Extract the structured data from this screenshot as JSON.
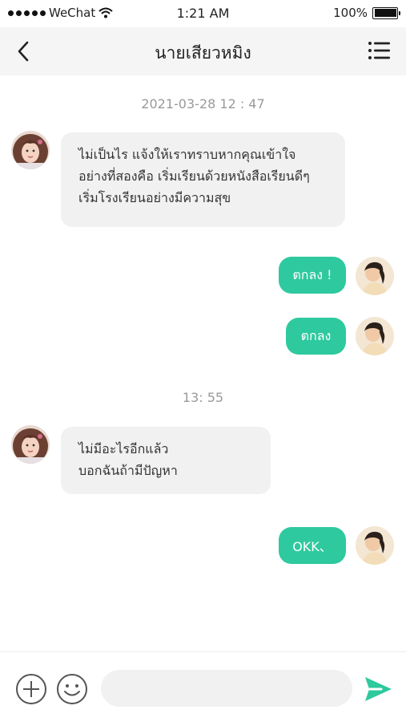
{
  "status_bar": {
    "carrier": "WeChat",
    "time": "1:21 AM",
    "battery": "100%"
  },
  "nav": {
    "title": "นายเสียวหมิง",
    "back_icon": "chevron-left-icon",
    "menu_icon": "list-menu-icon"
  },
  "chat": {
    "timestamps": [
      "2021-03-28  12 : 47",
      "13:  55"
    ],
    "messages": [
      {
        "side": "in",
        "lines": [
          "ไม่เป็นไร แจ้งให้เราทราบหากคุณเข้าใจ",
          "อย่างที่สองคือ เริ่มเรียนด้วยหนังสือเรียนดีๆ",
          "เริ่มโรงเรียนอย่างมีความสุข"
        ]
      },
      {
        "side": "out",
        "text": "ตกลง !"
      },
      {
        "side": "out",
        "text": "ตกลง"
      },
      {
        "side": "in",
        "lines": [
          "ไม่มีอะไรอีกแล้ว",
          "บอกฉันถ้ามีปัญหา"
        ]
      },
      {
        "side": "out",
        "text": "OKK、"
      }
    ]
  },
  "input_bar": {
    "add_icon": "plus-circle-icon",
    "emoji_icon": "smiley-icon",
    "placeholder": "",
    "send_icon": "send-icon"
  },
  "colors": {
    "accent": "#2ec99e",
    "incoming_bubble": "#f1f1f1",
    "nav_bg": "#f5f5f5",
    "timestamp": "#9a9a9a"
  }
}
